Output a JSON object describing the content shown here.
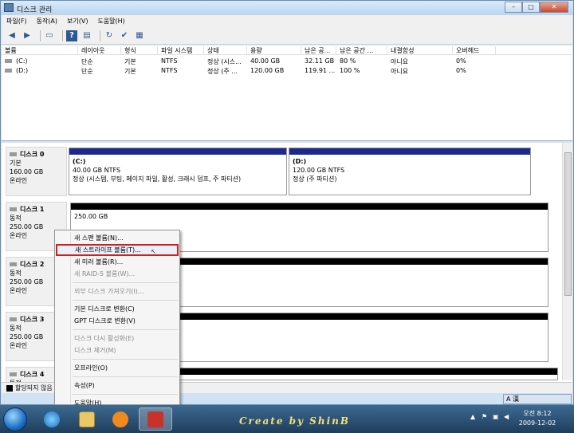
{
  "window": {
    "title": "디스크 관리",
    "btn_min": "–",
    "btn_max": "□",
    "btn_close": "✕"
  },
  "menu": [
    "파일(F)",
    "동작(A)",
    "보기(V)",
    "도움말(H)"
  ],
  "toolbar": [
    "back-icon",
    "forward-icon",
    "up-icon",
    "help-icon",
    "properties-icon",
    "refresh-icon",
    "settings-icon",
    "export-icon"
  ],
  "volume_table": {
    "headers": [
      "볼륨",
      "레이아웃",
      "형식",
      "파일 시스템",
      "상태",
      "용량",
      "남은 공...",
      "남은 공간 ...",
      "내결함성",
      "오버헤드"
    ],
    "rows": [
      [
        "(C:)",
        "단순",
        "기본",
        "NTFS",
        "정상 (시스...",
        "40.00 GB",
        "32.11 GB",
        "80 %",
        "아니요",
        "0%"
      ],
      [
        "(D:)",
        "단순",
        "기본",
        "NTFS",
        "정상 (주 ...",
        "120.00 GB",
        "119.91 ...",
        "100 %",
        "아니요",
        "0%"
      ]
    ]
  },
  "disks": [
    {
      "name": "디스크 0",
      "type": "기본",
      "size": "160.00 GB",
      "status": "온라인",
      "partitions": [
        {
          "label": "(C:)",
          "size": "40.00 GB NTFS",
          "status": "정상 (시스템, 부팅, 페이지 파일, 활성, 크래시 덤프, 주 파티션)"
        },
        {
          "label": "(D:)",
          "size": "120.00 GB NTFS",
          "status": "정상 (주 파티션)"
        }
      ]
    },
    {
      "name": "디스크 1",
      "type": "동적",
      "size": "250.00 GB",
      "status": "온라인",
      "unalloc_size": "250.00 GB"
    },
    {
      "name": "디스크 2",
      "type": "동적",
      "size": "250.00 GB",
      "status": "온라인"
    },
    {
      "name": "디스크 3",
      "type": "동적",
      "size": "250.00 GB",
      "status": "온라인"
    },
    {
      "name": "디스크 4",
      "type": "동적"
    }
  ],
  "status_bar": {
    "legend": "할당되지 않음"
  },
  "context_menu": {
    "items": [
      {
        "label": "새 스팬 볼륨(N)...",
        "disabled": false
      },
      {
        "label": "새 스트라이프 볼륨(T)...",
        "disabled": false,
        "highlighted": true
      },
      {
        "label": "새 미러 볼륨(R)...",
        "disabled": false
      },
      {
        "label": "새 RAID-5 볼륨(W)...",
        "disabled": true
      },
      {
        "label": "외부 디스크 가져오기(I)...",
        "disabled": true
      },
      {
        "label": "기본 디스크로 변환(C)",
        "disabled": false
      },
      {
        "label": "GPT 디스크로 변환(V)",
        "disabled": false
      },
      {
        "label": "디스크 다시 활성화(E)",
        "disabled": true
      },
      {
        "label": "디스크 제거(M)",
        "disabled": true
      },
      {
        "label": "오프라인(O)",
        "disabled": false
      },
      {
        "label": "속성(P)",
        "disabled": false
      },
      {
        "label": "도움말(H)",
        "disabled": false
      }
    ]
  },
  "taskbar": {
    "caption": "Create by ShinB",
    "time": "오전 8:12",
    "date": "2009-12-02",
    "lang": "A 漢"
  },
  "colors": {
    "primary_partition": "#1b2a8c",
    "unallocated": "#000000",
    "highlight_border": "#d21f1f"
  }
}
